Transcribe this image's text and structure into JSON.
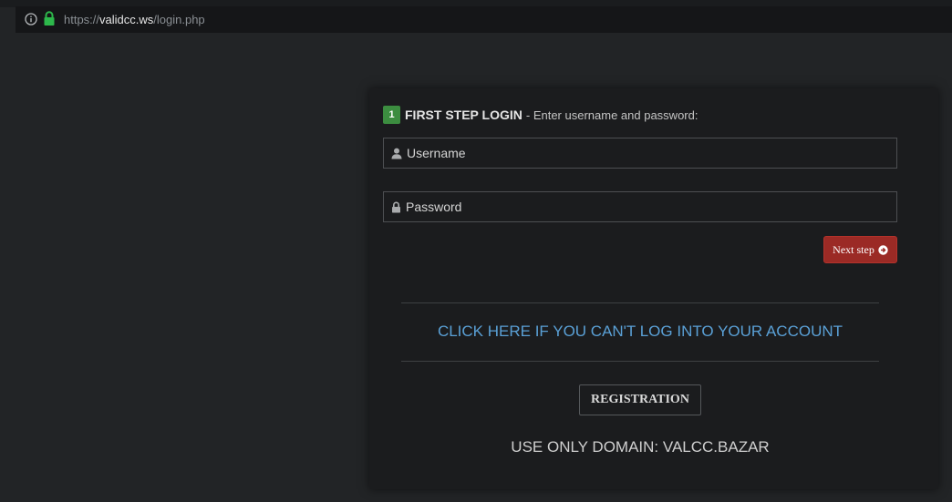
{
  "browser": {
    "url_scheme": "https://",
    "url_host": "validcc.ws",
    "url_path": "/login.php",
    "info_icon": "info-icon",
    "secure_icon": "lock-icon",
    "secure_color": "#2db84b"
  },
  "login": {
    "step_number": "1",
    "step_title": "FIRST STEP LOGIN",
    "step_description": "- Enter username and password:",
    "username_placeholder": "Username",
    "username_value": "",
    "username_icon": "user-icon",
    "password_placeholder": "Password",
    "password_value": "",
    "password_icon": "lock-icon",
    "next_button_label": "Next step",
    "next_button_icon": "arrow-circle-right-icon",
    "cant_login_link": "CLICK HERE IF YOU CAN'T LOG INTO YOUR ACCOUNT",
    "registration_button": "REGISTRATION",
    "domain_note": "USE ONLY DOMAIN: VALCC.BAZAR"
  },
  "colors": {
    "page_bg": "#222426",
    "panel_bg": "#1b1c1e",
    "step_badge": "#3c8d40",
    "next_button": "#9b2a25",
    "link": "#5aa0d6"
  }
}
